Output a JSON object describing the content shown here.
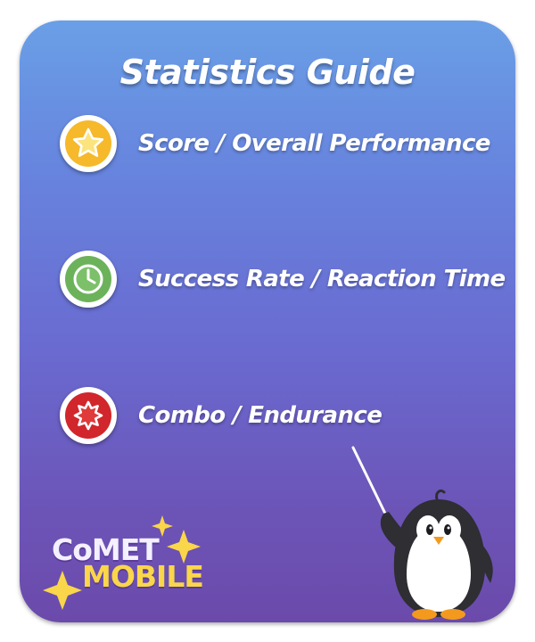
{
  "title": "Statistics Guide",
  "items": [
    {
      "label": "Score / Overall Performance",
      "icon": "star-icon",
      "color": "#f6b92b"
    },
    {
      "label": "Success Rate / Reaction Time",
      "icon": "clock-icon",
      "color": "#6cb25b"
    },
    {
      "label": "Combo / Endurance",
      "icon": "burst-icon",
      "color": "#d1262c"
    }
  ],
  "logo": {
    "line1": "CoMET",
    "line2": "MOBILE"
  },
  "colors": {
    "gradient_top": "#6a9fe6",
    "gradient_bottom": "#6b4aab",
    "logo_purple": "#ffffff",
    "logo_yellow": "#f9d64a"
  }
}
